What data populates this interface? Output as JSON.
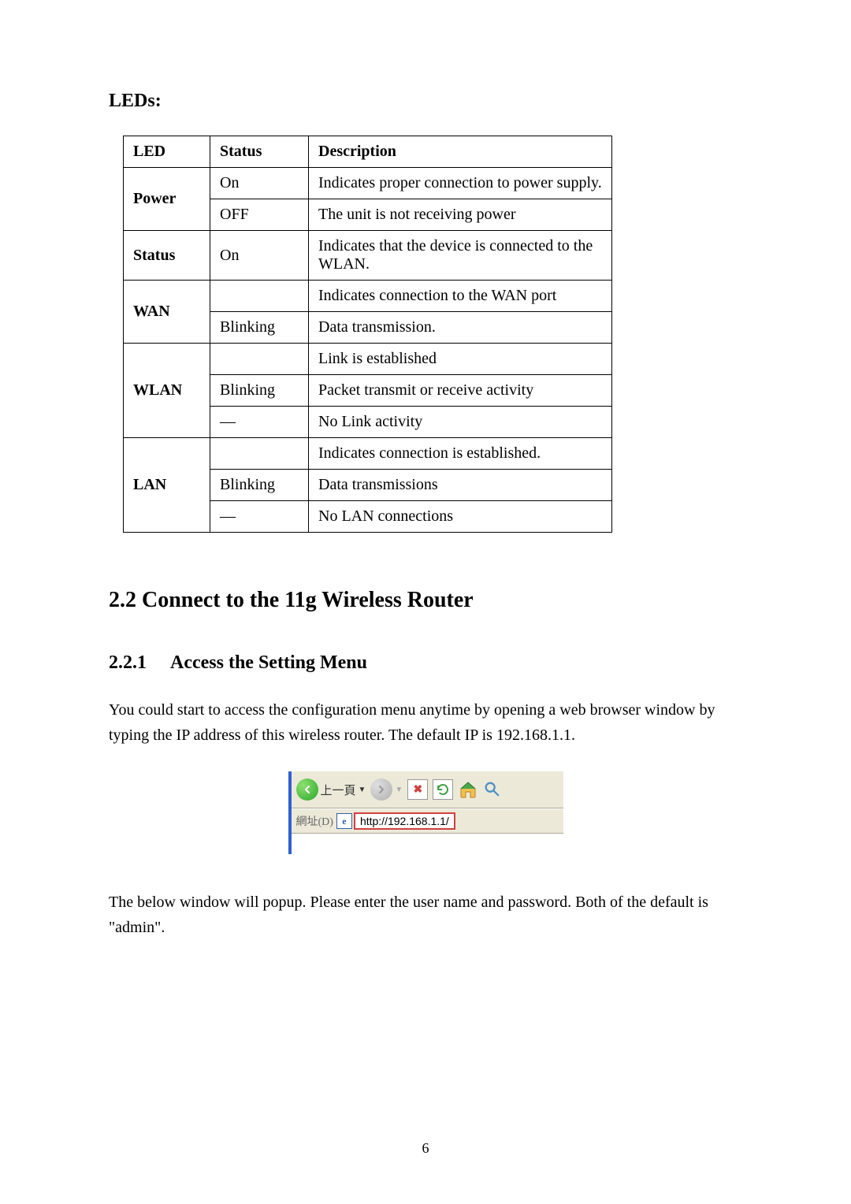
{
  "section_leds_heading": "LEDs:",
  "table": {
    "headers": {
      "led": "LED",
      "status": "Status",
      "desc": "Description"
    },
    "rows": [
      {
        "led": "Power",
        "rowspan": 2,
        "cells": [
          [
            "On",
            "Indicates proper connection to power supply."
          ],
          [
            "OFF",
            "The unit is not receiving power"
          ]
        ]
      },
      {
        "led": "Status",
        "rowspan": 1,
        "cells": [
          [
            "On",
            "Indicates that the device is connected to the WLAN."
          ]
        ]
      },
      {
        "led": "WAN",
        "rowspan": 2,
        "cells": [
          [
            "",
            "Indicates connection to the WAN port"
          ],
          [
            "Blinking",
            "Data transmission."
          ]
        ]
      },
      {
        "led": "WLAN",
        "rowspan": 3,
        "cells": [
          [
            "",
            "Link is established"
          ],
          [
            "Blinking",
            "Packet transmit or receive activity"
          ],
          [
            "—",
            "No Link activity"
          ]
        ]
      },
      {
        "led": "LAN",
        "rowspan": 3,
        "cells": [
          [
            "",
            "Indicates connection is established."
          ],
          [
            "Blinking",
            "Data transmissions"
          ],
          [
            "—",
            "No LAN connections"
          ]
        ]
      }
    ]
  },
  "section_22_heading": "2.2 Connect to the 11g Wireless Router",
  "section_221_num": "2.2.1",
  "section_221_title": "Access the Setting Menu",
  "para1": "You could start to access the configuration menu anytime by opening a web browser window by typing the IP address of this wireless router.    The default IP is 192.168.1.1.",
  "ie": {
    "back_label": "上一頁",
    "address_label": "網址(D)",
    "url": "http://192.168.1.1/"
  },
  "para2": "The below window will popup.    Please enter the user name and password.    Both of the default is \"admin\".",
  "page_number": "6"
}
